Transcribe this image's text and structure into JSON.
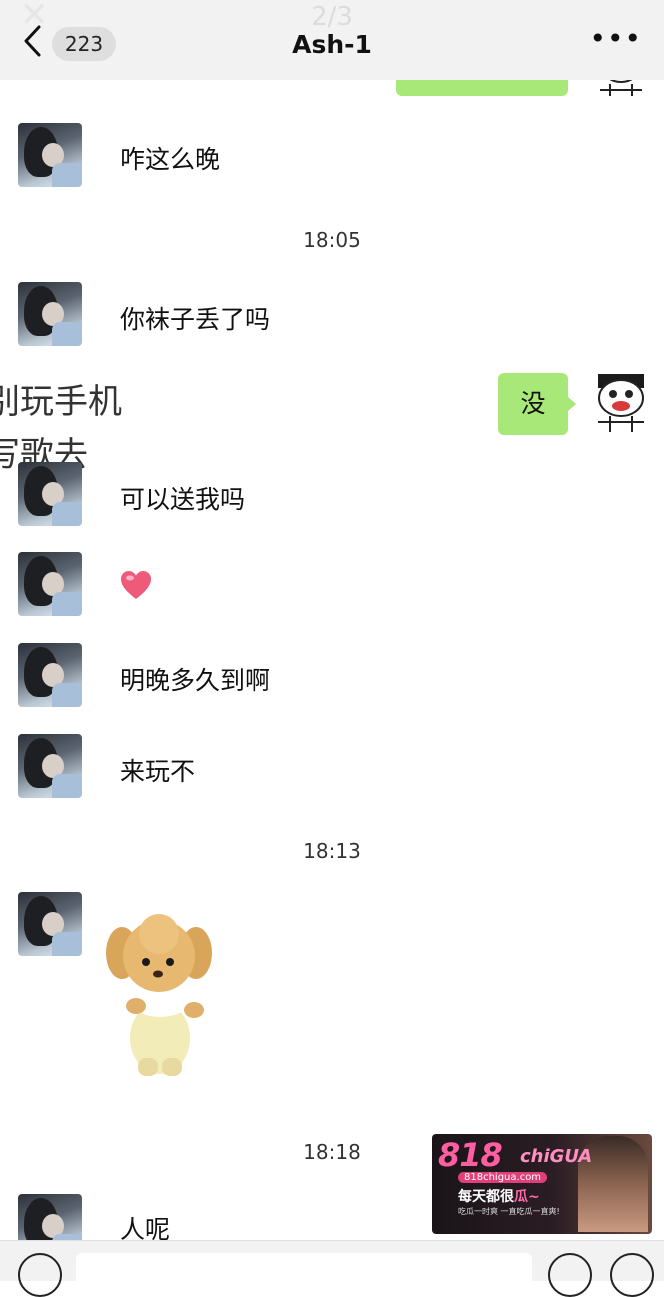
{
  "header": {
    "page_indicator": "2/3",
    "unread_count": "223",
    "title": "Ash-1"
  },
  "times": {
    "t1": "18:05",
    "t2": "18:13",
    "t3": "18:18"
  },
  "messages": {
    "m1": "咋这么晚",
    "m2": "你袜子丢了吗",
    "out1": "没",
    "m3": "可以送我吗",
    "m4": "明晚多久到啊",
    "m5": "来玩不",
    "m6": "人呢"
  },
  "overlay_caption": {
    "line1": "别玩手机",
    "line2": "写歌去"
  },
  "ad": {
    "brand": "818",
    "brand_sub": "chiGUA",
    "url": "818chigua.com",
    "slogan_a": "每天都很",
    "slogan_b": "瓜~",
    "tagline": "吃瓜一时爽 一直吃瓜一直爽!"
  },
  "colors": {
    "bubble_green": "#a8e878",
    "bar_gray": "#f2f2f2"
  }
}
